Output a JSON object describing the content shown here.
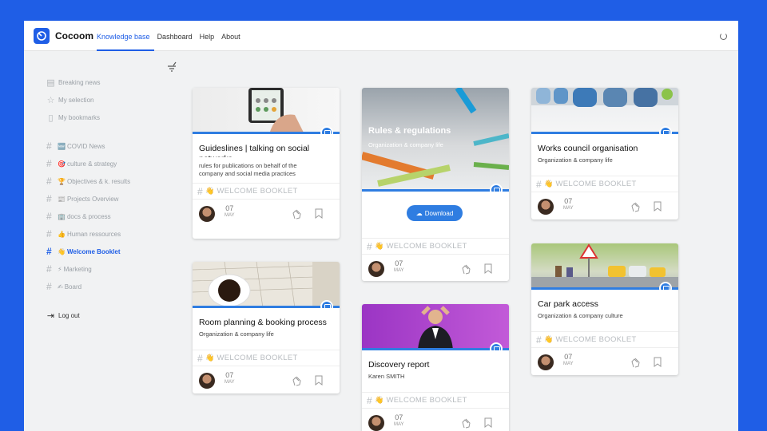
{
  "app": {
    "brand": "Cocoom"
  },
  "nav": {
    "items": [
      "Knowledge base",
      "Dashboard",
      "Help",
      "About"
    ]
  },
  "sidebar": {
    "menu": [
      {
        "label": "Breaking news",
        "icon": "news-icon"
      },
      {
        "label": "My selection",
        "icon": "star-icon"
      },
      {
        "label": "My bookmarks",
        "icon": "bookmark-icon"
      }
    ],
    "tags": [
      {
        "emoji": "🆕",
        "label": "COVID News"
      },
      {
        "emoji": "🎯",
        "label": "culture & strategy"
      },
      {
        "emoji": "🏆",
        "label": "Objectives & k. results"
      },
      {
        "emoji": "📰",
        "label": "Projects Overview"
      },
      {
        "emoji": "🏢",
        "label": "docs & process"
      },
      {
        "emoji": "👍",
        "label": "Human ressources"
      },
      {
        "emoji": "👋",
        "label": "Welcome Booklet"
      },
      {
        "emoji": "⚡",
        "label": "Marketing"
      },
      {
        "emoji": "✍",
        "label": "Board"
      }
    ],
    "logout": "Log out"
  },
  "tag_text": "WELCOME BOOKLET",
  "cards": [
    {
      "title": "Guideslines | talking on social networks",
      "subtitle": "rules for publications on behalf of the company and social media practices",
      "day": "07",
      "month": "MAY"
    },
    {
      "title": "Room planning & booking process",
      "subtitle": "Organization & company life",
      "day": "07",
      "month": "MAY"
    },
    {
      "title": "Rules & regulations",
      "subtitle": "Organization & company life",
      "button": "Download",
      "day": "07",
      "month": "MAY"
    },
    {
      "title": "Discovery report",
      "subtitle": "Karen SMITH",
      "day": "07",
      "month": "MAY"
    },
    {
      "title": "Works council organisation",
      "subtitle": "Organization & company life",
      "day": "07",
      "month": "MAY"
    },
    {
      "title": "Car park access",
      "subtitle": "Organization & company culture",
      "day": "07",
      "month": "MAY"
    }
  ]
}
